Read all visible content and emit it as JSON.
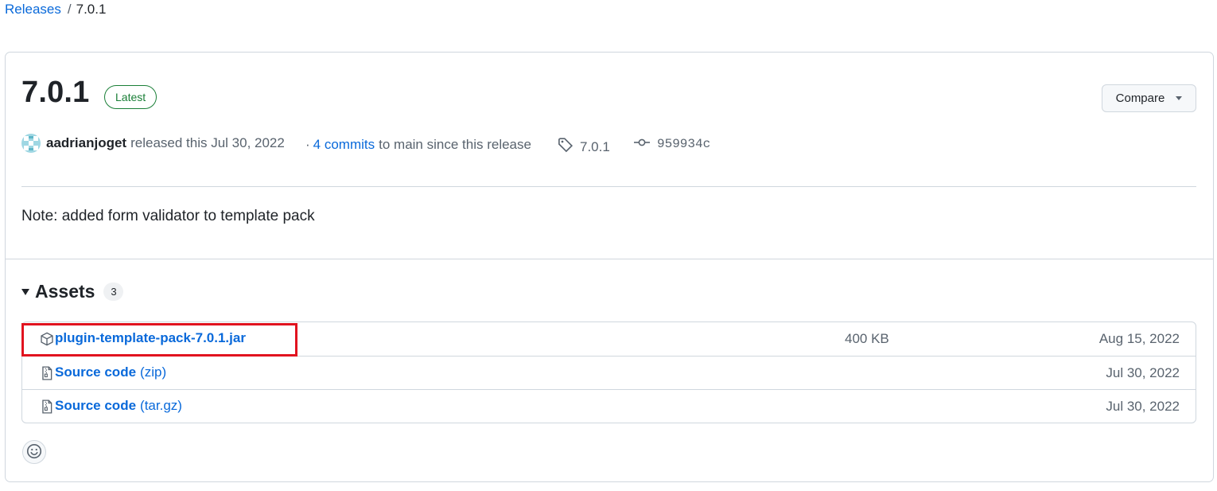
{
  "breadcrumb": {
    "releases": "Releases",
    "separator": "/",
    "current": "7.0.1"
  },
  "release": {
    "title": "7.0.1",
    "badge": "Latest",
    "compare_label": "Compare",
    "author": "aadrianjoget",
    "released_text": "released this Jul 30, 2022",
    "commits_prefix": "·",
    "commits_link": "4 commits",
    "commits_suffix": "to main since this release",
    "tag": "7.0.1",
    "commit_sha": "959934c",
    "notes": "Note: added form validator to template pack"
  },
  "assets": {
    "title": "Assets",
    "count": "3",
    "items": [
      {
        "icon": "package-icon",
        "name": "plugin-template-pack-7.0.1.jar",
        "suffix": "",
        "size": "400 KB",
        "date": "Aug 15, 2022"
      },
      {
        "icon": "file-zip-icon",
        "name": "Source code",
        "suffix": "(zip)",
        "size": "",
        "date": "Jul 30, 2022"
      },
      {
        "icon": "file-zip-icon",
        "name": "Source code",
        "suffix": "(tar.gz)",
        "size": "",
        "date": "Jul 30, 2022"
      }
    ]
  },
  "colors": {
    "link": "#0969da",
    "latest": "#1a7f37",
    "highlight": "#e1131f",
    "border": "#d0d7de"
  }
}
